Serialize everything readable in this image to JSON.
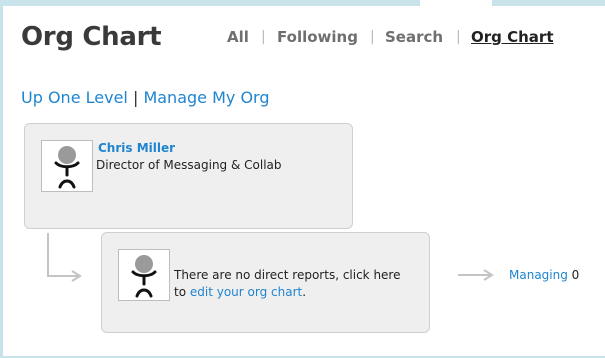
{
  "header": {
    "title": "Org Chart",
    "nav": [
      {
        "label": "All",
        "active": false
      },
      {
        "label": "Following",
        "active": false
      },
      {
        "label": "Search",
        "active": false
      },
      {
        "label": "Org Chart",
        "active": true
      }
    ],
    "separator": "|"
  },
  "links": {
    "up_one_level": "Up One Level",
    "separator": "|",
    "manage_my_org": "Manage My Org"
  },
  "manager_card": {
    "name": "Chris Miller",
    "title": "Director of Messaging & Collab",
    "avatar_icon": "person-placeholder-icon"
  },
  "reports_card": {
    "message_line1": "There are no direct reports, click here",
    "message_prefix": "to ",
    "edit_link": "edit your org chart",
    "message_suffix": ".",
    "avatar_icon": "person-placeholder-icon"
  },
  "managing": {
    "label": "Managing",
    "count": "0"
  },
  "colors": {
    "link": "#1f85d0",
    "background": "#c9e3ea",
    "card": "#efefef"
  }
}
